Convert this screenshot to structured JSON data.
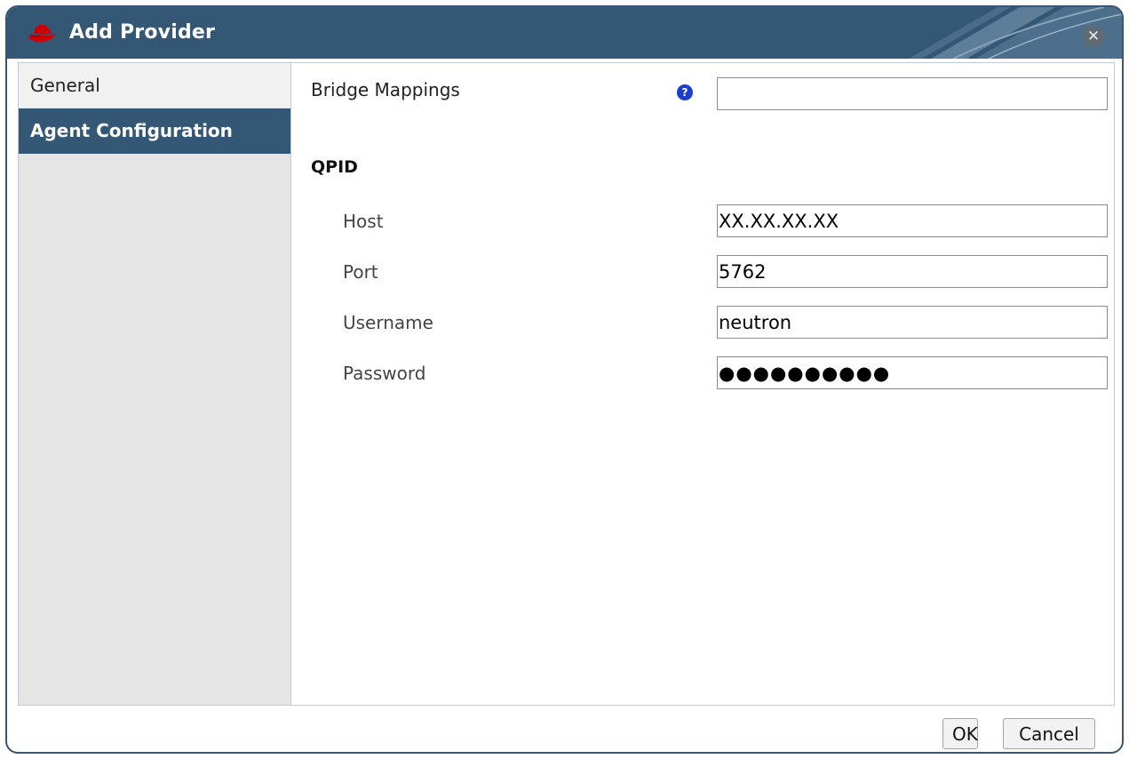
{
  "dialog": {
    "title": "Add Provider",
    "logo_icon": "redhat-hat-icon",
    "close_icon": "close-icon",
    "accent_color": "#355776"
  },
  "sidebar": {
    "items": [
      {
        "label": "General",
        "active": false
      },
      {
        "label": "Agent Configuration",
        "active": true
      }
    ]
  },
  "form": {
    "bridge_mappings": {
      "label": "Bridge Mappings",
      "value": "",
      "help_icon": "help-icon"
    },
    "qpid": {
      "section_title": "QPID",
      "host": {
        "label": "Host",
        "value": "XX.XX.XX.XX"
      },
      "port": {
        "label": "Port",
        "value": "5762"
      },
      "username": {
        "label": "Username",
        "value": "neutron"
      },
      "password": {
        "label": "Password",
        "value": "●●●●●●●●●●"
      }
    }
  },
  "buttons": {
    "ok": "OK",
    "cancel": "Cancel"
  }
}
